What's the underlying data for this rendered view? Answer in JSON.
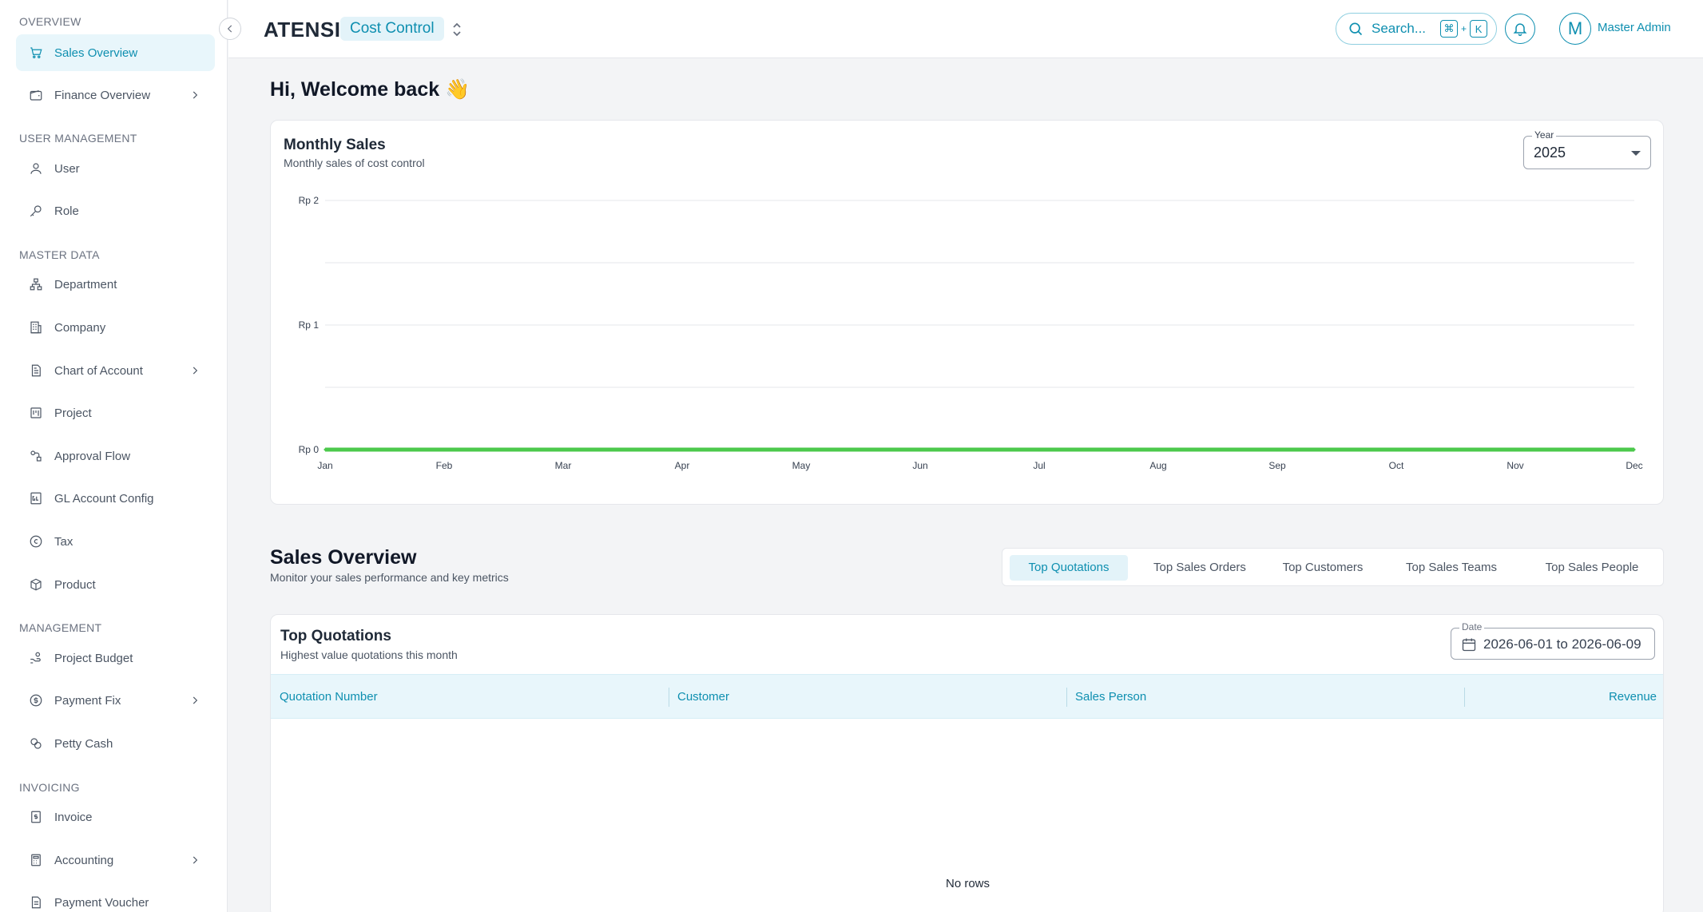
{
  "sidebar": {
    "sections": [
      {
        "title": "OVERVIEW"
      },
      {
        "title": "USER MANAGEMENT"
      },
      {
        "title": "MASTER DATA"
      },
      {
        "title": "MANAGEMENT"
      },
      {
        "title": "INVOICING"
      }
    ],
    "items": [
      {
        "label": "Sales Overview",
        "icon": "cart-icon",
        "active": true
      },
      {
        "label": "Finance Overview",
        "icon": "wallet-icon",
        "has_children": true
      },
      {
        "label": "User",
        "icon": "user-icon"
      },
      {
        "label": "Role",
        "icon": "key-icon"
      },
      {
        "label": "Department",
        "icon": "org-chart-icon"
      },
      {
        "label": "Company",
        "icon": "building-icon"
      },
      {
        "label": "Chart of Account",
        "icon": "document-icon",
        "has_children": true
      },
      {
        "label": "Project",
        "icon": "kanban-icon"
      },
      {
        "label": "Approval Flow",
        "icon": "flow-icon"
      },
      {
        "label": "GL Account Config",
        "icon": "gl-icon"
      },
      {
        "label": "Tax",
        "icon": "tax-icon"
      },
      {
        "label": "Product",
        "icon": "box-icon"
      },
      {
        "label": "Project Budget",
        "icon": "budget-icon"
      },
      {
        "label": "Payment Fix",
        "icon": "dollar-circle-icon",
        "has_children": true
      },
      {
        "label": "Petty Cash",
        "icon": "coins-icon"
      },
      {
        "label": "Invoice",
        "icon": "invoice-icon"
      },
      {
        "label": "Accounting",
        "icon": "calculator-icon",
        "has_children": true
      },
      {
        "label": "Payment Voucher",
        "icon": "voucher-icon"
      }
    ]
  },
  "header": {
    "brand": "ATENSI",
    "app_name": "Cost Control",
    "search_label": "Search...",
    "shortcut_cmd": "⌘",
    "shortcut_plus": "+",
    "shortcut_key": "K",
    "user_initial": "M",
    "user_name": "Master Admin"
  },
  "welcome": "Hi, Welcome back 👋",
  "monthly_sales": {
    "title": "Monthly Sales",
    "subtitle": "Monthly sales of cost control",
    "year_label": "Year",
    "year_value": "2025"
  },
  "chart_data": {
    "type": "line",
    "title": "Monthly Sales",
    "x": [
      "Jan",
      "Feb",
      "Mar",
      "Apr",
      "May",
      "Jun",
      "Jul",
      "Aug",
      "Sep",
      "Oct",
      "Nov",
      "Dec"
    ],
    "series": [
      {
        "values": [
          0,
          0,
          0,
          0,
          0,
          0,
          0,
          0,
          0,
          0,
          0,
          0
        ],
        "color": "#4cc94c"
      }
    ],
    "yticks": [
      "Rp 0",
      "Rp 1",
      "Rp 2"
    ],
    "ylim": [
      0,
      2
    ],
    "grid": true,
    "xlabel": "",
    "ylabel": ""
  },
  "sales_overview": {
    "title": "Sales Overview",
    "subtitle": "Monitor your sales performance and key metrics",
    "tabs": [
      {
        "label": "Top Quotations",
        "active": true
      },
      {
        "label": "Top Sales Orders"
      },
      {
        "label": "Top Customers"
      },
      {
        "label": "Top Sales Teams"
      },
      {
        "label": "Top Sales People"
      }
    ]
  },
  "top_quotations": {
    "title": "Top Quotations",
    "subtitle": "Highest value quotations this month",
    "date_label": "Date",
    "date_value": "2026-06-01 to 2026-06-09",
    "columns": [
      "Quotation Number",
      "Customer",
      "Sales Person",
      "Revenue"
    ],
    "rows": [],
    "empty_text": "No rows"
  },
  "colors": {
    "accent": "#0e8fb0",
    "accent_bg": "#e3f3f9",
    "line": "#4cc94c"
  }
}
